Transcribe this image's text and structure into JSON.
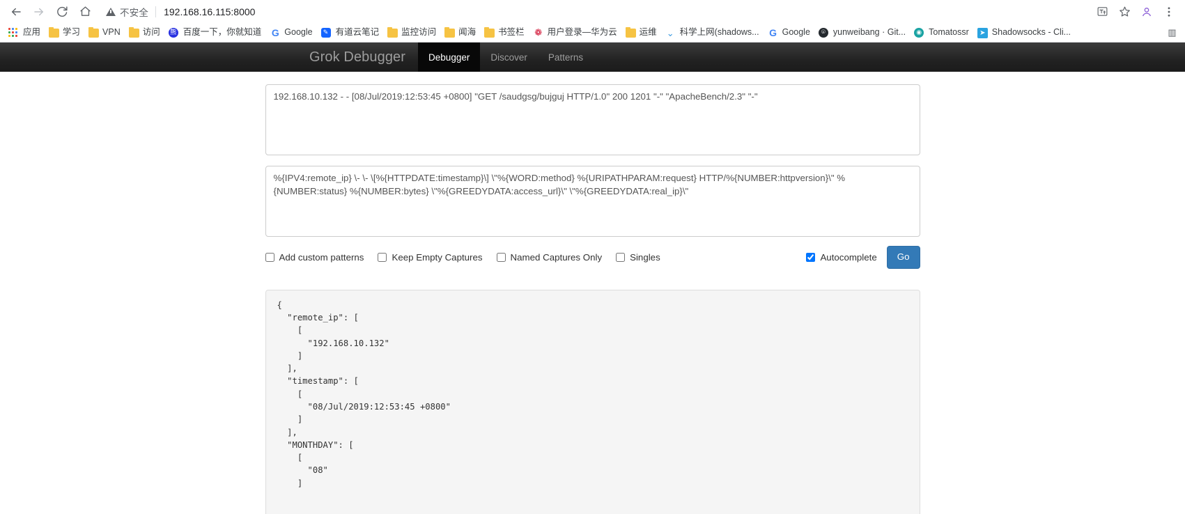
{
  "browser": {
    "back_icon": "back-arrow-icon",
    "forward_icon": "forward-arrow-icon",
    "reload_icon": "reload-icon",
    "home_icon": "home-icon",
    "security_label": "不安全",
    "url": "192.168.16.115:8000",
    "translate_icon": "translate-icon",
    "bookmark_star_icon": "star-icon",
    "profile_icon": "profile-icon",
    "menu_icon": "more-options-icon",
    "bookmarks": [
      {
        "label": "应用",
        "icon": "apps-grid-icon"
      },
      {
        "label": "学习",
        "icon": "folder-icon"
      },
      {
        "label": "VPN",
        "icon": "folder-icon"
      },
      {
        "label": "访问",
        "icon": "folder-icon"
      },
      {
        "label": "百度一下，你就知道",
        "icon": "baidu-icon"
      },
      {
        "label": "Google",
        "icon": "google-icon"
      },
      {
        "label": "有道云笔记",
        "icon": "youdao-icon"
      },
      {
        "label": "监控访问",
        "icon": "folder-icon"
      },
      {
        "label": "闻海",
        "icon": "folder-icon"
      },
      {
        "label": "书签栏",
        "icon": "folder-icon"
      },
      {
        "label": "用户登录—华为云",
        "icon": "huawei-icon"
      },
      {
        "label": "运维",
        "icon": "folder-icon"
      },
      {
        "label": "科学上网(shadows...",
        "icon": "shadowsocks-icon"
      },
      {
        "label": "Google",
        "icon": "google-icon"
      },
      {
        "label": "yunweibang · Git...",
        "icon": "github-icon"
      },
      {
        "label": "Tomatossr",
        "icon": "tomato-icon"
      },
      {
        "label": "Shadowsocks - Cli...",
        "icon": "telegram-icon"
      }
    ],
    "bookmarks_overflow_icon": "reading-list-icon"
  },
  "app": {
    "brand": "Grok Debugger",
    "tabs": [
      {
        "label": "Debugger",
        "active": true
      },
      {
        "label": "Discover",
        "active": false
      },
      {
        "label": "Patterns",
        "active": false
      }
    ]
  },
  "form": {
    "input_value": "192.168.10.132 - - [08/Jul/2019:12:53:45 +0800] \"GET /saudgsg/bujguj HTTP/1.0\" 200 1201 \"-\" \"ApacheBench/2.3\" \"-\"",
    "pattern_value": "%{IPV4:remote_ip} \\- \\- \\[%{HTTPDATE:timestamp}\\] \\\"%{WORD:method} %{URIPATHPARAM:request} HTTP/%{NUMBER:httpversion}\\\" %{NUMBER:status} %{NUMBER:bytes} \\\"%{GREEDYDATA:access_url}\\\" \\\"%{GREEDYDATA:real_ip}\\\"",
    "options": [
      {
        "label": "Add custom patterns",
        "checked": false
      },
      {
        "label": "Keep Empty Captures",
        "checked": false
      },
      {
        "label": "Named Captures Only",
        "checked": false
      },
      {
        "label": "Singles",
        "checked": false
      }
    ],
    "autocomplete": {
      "label": "Autocomplete",
      "checked": true
    },
    "go_button": "Go",
    "accent_color": "#337ab7"
  },
  "output": {
    "json_text": "{\n  \"remote_ip\": [\n    [\n      \"192.168.10.132\"\n    ]\n  ],\n  \"timestamp\": [\n    [\n      \"08/Jul/2019:12:53:45 +0800\"\n    ]\n  ],\n  \"MONTHDAY\": [\n    [\n      \"08\"\n    ]"
  }
}
